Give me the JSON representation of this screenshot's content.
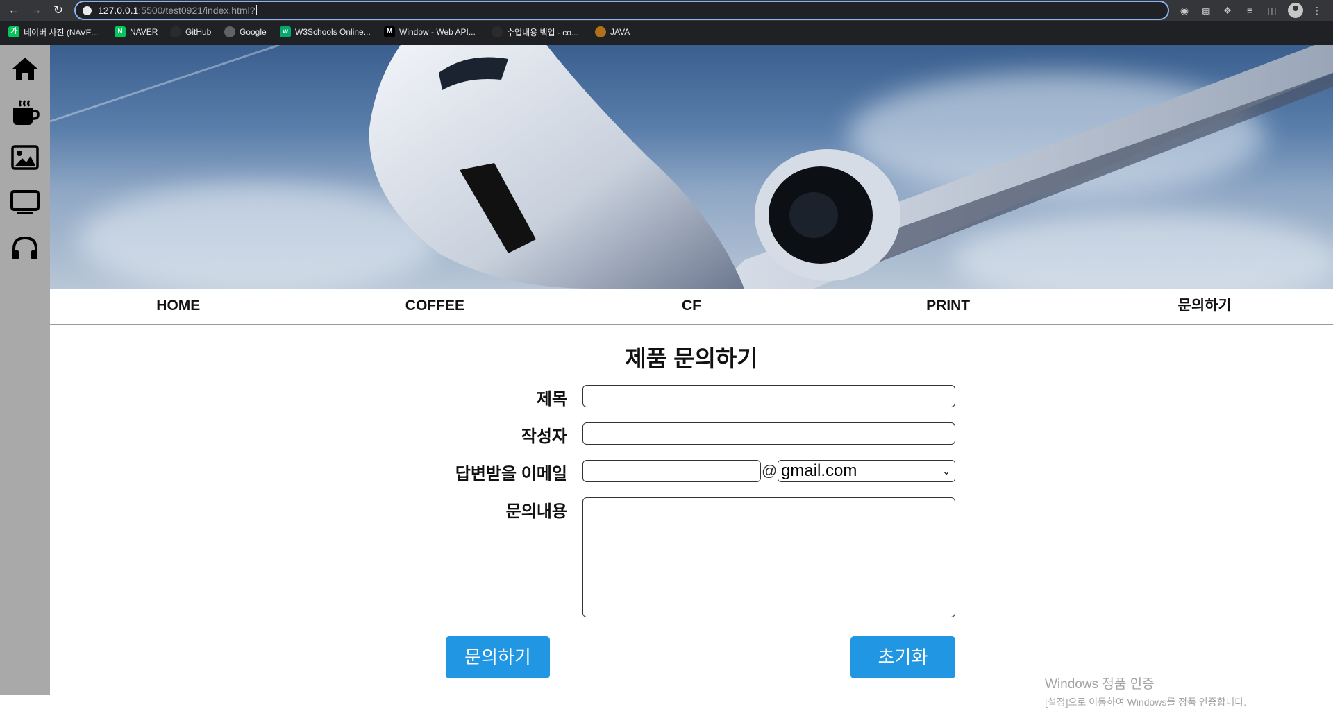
{
  "browser": {
    "url_host": "127.0.0.1",
    "url_path": ":5500/test0921/index.html?",
    "bookmarks": [
      {
        "label": "네이버 사전 (NAVE...",
        "icon": "naver-dict-icon",
        "color": "#03c75a",
        "glyph": "가"
      },
      {
        "label": "NAVER",
        "icon": "naver-icon",
        "color": "#03c75a",
        "glyph": "N"
      },
      {
        "label": "GitHub",
        "icon": "github-icon",
        "color": "#2b2b2b",
        "glyph": ""
      },
      {
        "label": "Google",
        "icon": "google-icon",
        "color": "#5f6368",
        "glyph": ""
      },
      {
        "label": "W3Schools Online...",
        "icon": "w3schools-icon",
        "color": "#04aa6d",
        "glyph": "w"
      },
      {
        "label": "Window - Web API...",
        "icon": "mdn-icon",
        "color": "#000000",
        "glyph": "M"
      },
      {
        "label": "수업내용 백업 · co...",
        "icon": "notion-icon",
        "color": "#2b2b2b",
        "glyph": ""
      },
      {
        "label": "JAVA",
        "icon": "java-icon",
        "color": "#b07219",
        "glyph": ""
      }
    ]
  },
  "sidebar": {
    "icons": [
      "home-icon",
      "coffee-icon",
      "image-icon",
      "tv-icon",
      "headphones-icon"
    ]
  },
  "nav": {
    "items": [
      "HOME",
      "COFFEE",
      "CF",
      "PRINT",
      "문의하기"
    ]
  },
  "form": {
    "title": "제품 문의하기",
    "labels": {
      "subject": "제목",
      "author": "작성자",
      "email": "답변받을 이메일",
      "content": "문의내용"
    },
    "at_sign": "@",
    "email_domain_selected": "gmail.com",
    "submit_label": "문의하기",
    "reset_label": "초기화"
  },
  "watermark": {
    "line1": "Windows 정품 인증",
    "line2": "[설정]으로 이동하여 Windows를 정품 인증합니다."
  },
  "colors": {
    "accent": "#2196e3",
    "sidebar": "#a9a9a9",
    "chrome": "#202124"
  }
}
